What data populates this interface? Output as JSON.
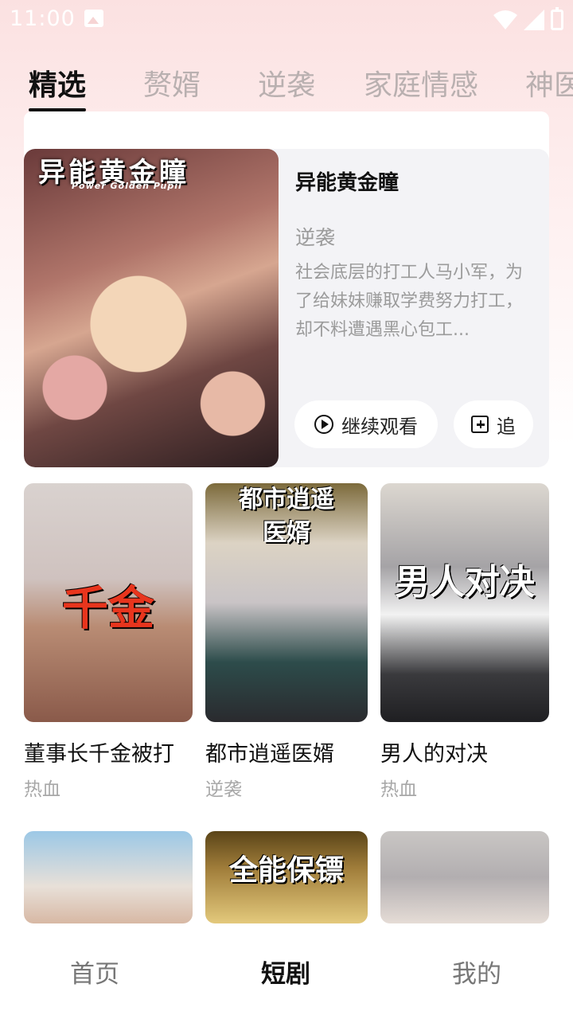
{
  "status_bar": {
    "time": "11:00"
  },
  "tabs": [
    {
      "label": "精选",
      "active": true
    },
    {
      "label": "赘婿",
      "active": false
    },
    {
      "label": "逆袭",
      "active": false
    },
    {
      "label": "家庭情感",
      "active": false
    },
    {
      "label": "神医",
      "active": false
    }
  ],
  "featured": {
    "poster_title": "异能黄金瞳",
    "poster_subtitle": "Power Golden Pupil",
    "title": "异能黄金瞳",
    "genre": "逆袭",
    "description": "社会底层的打工人马小军，为了给妹妹赚取学费努力打工，却不料遭遇黑心包工...",
    "continue_label": "继续观看",
    "follow_label": "追"
  },
  "grid": [
    {
      "title": "董事长千金被打",
      "genre": "热血",
      "poster_text": "千金"
    },
    {
      "title": "都市逍遥医婿",
      "genre": "逆袭",
      "poster_text": "都市逍遥医婿"
    },
    {
      "title": "男人的对决",
      "genre": "热血",
      "poster_text": "男人对决"
    },
    {
      "poster_text": ""
    },
    {
      "poster_text": "全能保镖"
    },
    {
      "poster_text": ""
    }
  ],
  "bottom_nav": [
    {
      "label": "首页",
      "active": false
    },
    {
      "label": "短剧",
      "active": true
    },
    {
      "label": "我的",
      "active": false
    }
  ],
  "colors": {
    "accent": "#111111",
    "muted": "#9b9b9b",
    "background_top": "#fbe1e1"
  }
}
